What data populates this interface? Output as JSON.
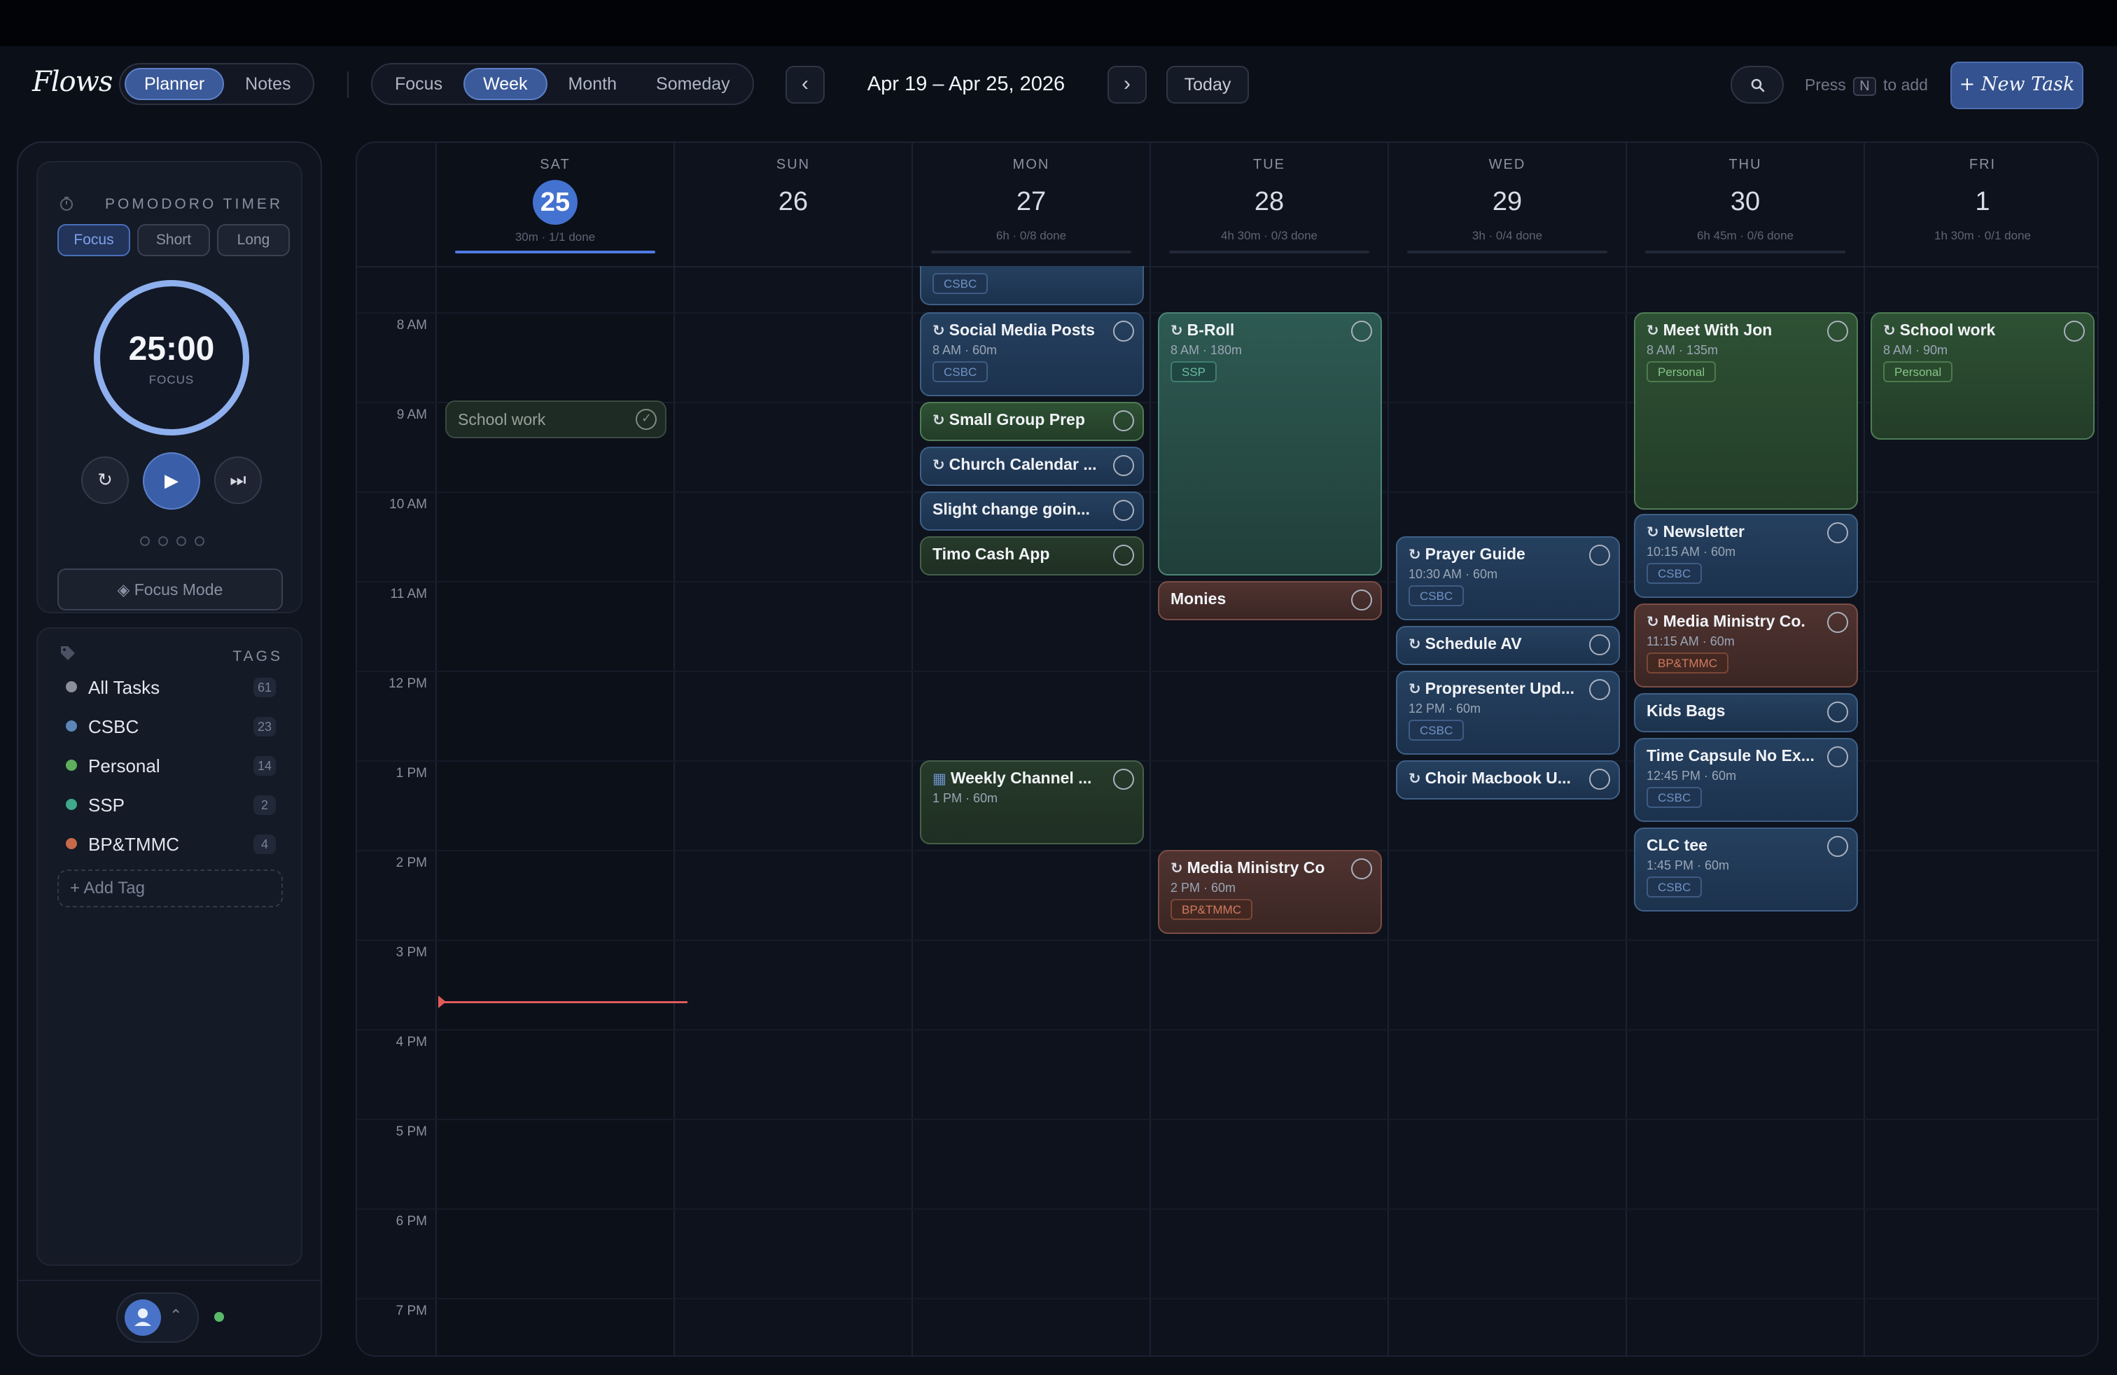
{
  "app": {
    "name": "Flows"
  },
  "views": {
    "planner": "Planner",
    "notes": "Notes"
  },
  "modes": [
    "Focus",
    "Week",
    "Month",
    "Someday"
  ],
  "active_mode": "Week",
  "nav": {
    "prev": "‹",
    "next": "›",
    "range": "Apr 19 – Apr 25, 2026",
    "today": "Today"
  },
  "hint": {
    "pre": "Press",
    "key": "N",
    "post": "to add"
  },
  "new_task": "+ New Task",
  "pomodoro": {
    "title": "POMODORO TIMER",
    "tabs": [
      "Focus",
      "Short",
      "Long"
    ],
    "time": "25:00",
    "label": "FOCUS",
    "focus_mode": "◈ Focus Mode"
  },
  "tags": {
    "title": "TAGS",
    "items": [
      {
        "name": "All Tasks",
        "count": "61",
        "color": "#8a8f9a"
      },
      {
        "name": "CSBC",
        "count": "23",
        "color": "#5b86b7"
      },
      {
        "name": "Personal",
        "count": "14",
        "color": "#5fae5d"
      },
      {
        "name": "SSP",
        "count": "2",
        "color": "#3fa98a"
      },
      {
        "name": "BP&TMMC",
        "count": "4",
        "color": "#c8694b"
      }
    ],
    "add": "+ Add Tag"
  },
  "days": [
    {
      "name": "SAT",
      "num": "25",
      "summary": "30m · 1/1 done",
      "today": true
    },
    {
      "name": "SUN",
      "num": "26",
      "summary": ""
    },
    {
      "name": "MON",
      "num": "27",
      "summary": "6h · 0/8 done"
    },
    {
      "name": "TUE",
      "num": "28",
      "summary": "4h 30m · 0/3 done"
    },
    {
      "name": "WED",
      "num": "29",
      "summary": "3h · 0/4 done"
    },
    {
      "name": "THU",
      "num": "30",
      "summary": "6h 45m · 0/6 done"
    },
    {
      "name": "FRI",
      "num": "1",
      "summary": "1h 30m · 0/1 done"
    }
  ],
  "hours": [
    "8 AM",
    "9 AM",
    "10 AM",
    "11 AM",
    "12 PM",
    "1 PM",
    "2 PM",
    "3 PM",
    "4 PM",
    "5 PM",
    "6 PM",
    "7 PM"
  ],
  "events": {
    "sat_school": {
      "title": "School work"
    },
    "mon_csbc_top": {
      "badge": "CSBC"
    },
    "mon_social": {
      "title": "Social Media Posts",
      "sub": "8 AM · 60m",
      "badge": "CSBC"
    },
    "mon_smallgroup": {
      "title": "Small Group Prep"
    },
    "mon_church": {
      "title": "Church Calendar ..."
    },
    "mon_slight": {
      "title": "Slight change goin..."
    },
    "mon_timo": {
      "title": "Timo Cash App"
    },
    "mon_weekly": {
      "title": "Weekly Channel ...",
      "sub": "1 PM · 60m"
    },
    "tue_broll": {
      "title": "B-Roll",
      "sub": "8 AM · 180m",
      "badge": "SSP"
    },
    "tue_monies": {
      "title": "Monies"
    },
    "tue_media": {
      "title": "Media Ministry Co",
      "sub": "2 PM · 60m",
      "badge": "BP&TMMC"
    },
    "wed_prayer": {
      "title": "Prayer Guide",
      "sub": "10:30 AM · 60m",
      "badge": "CSBC"
    },
    "wed_schedule": {
      "title": "Schedule AV"
    },
    "wed_propresenter": {
      "title": "Propresenter Upd...",
      "sub": "12 PM · 60m",
      "badge": "CSBC"
    },
    "wed_choir": {
      "title": "Choir Macbook U..."
    },
    "thu_jon": {
      "title": "Meet With Jon",
      "sub": "8 AM · 135m",
      "badge": "Personal"
    },
    "thu_newsletter": {
      "title": "Newsletter",
      "sub": "10:15 AM · 60m",
      "badge": "CSBC"
    },
    "thu_media": {
      "title": "Media Ministry Co.",
      "sub": "11:15 AM · 60m",
      "badge": "BP&TMMC"
    },
    "thu_kids": {
      "title": "Kids Bags"
    },
    "thu_capsule": {
      "title": "Time Capsule No Ex...",
      "sub": "12:45 PM · 60m",
      "badge": "CSBC"
    },
    "thu_clc": {
      "title": "CLC tee",
      "sub": "1:45 PM · 60m",
      "badge": "CSBC"
    },
    "fri_school": {
      "title": "School work",
      "sub": "8 AM · 90m",
      "badge": "Personal"
    }
  }
}
